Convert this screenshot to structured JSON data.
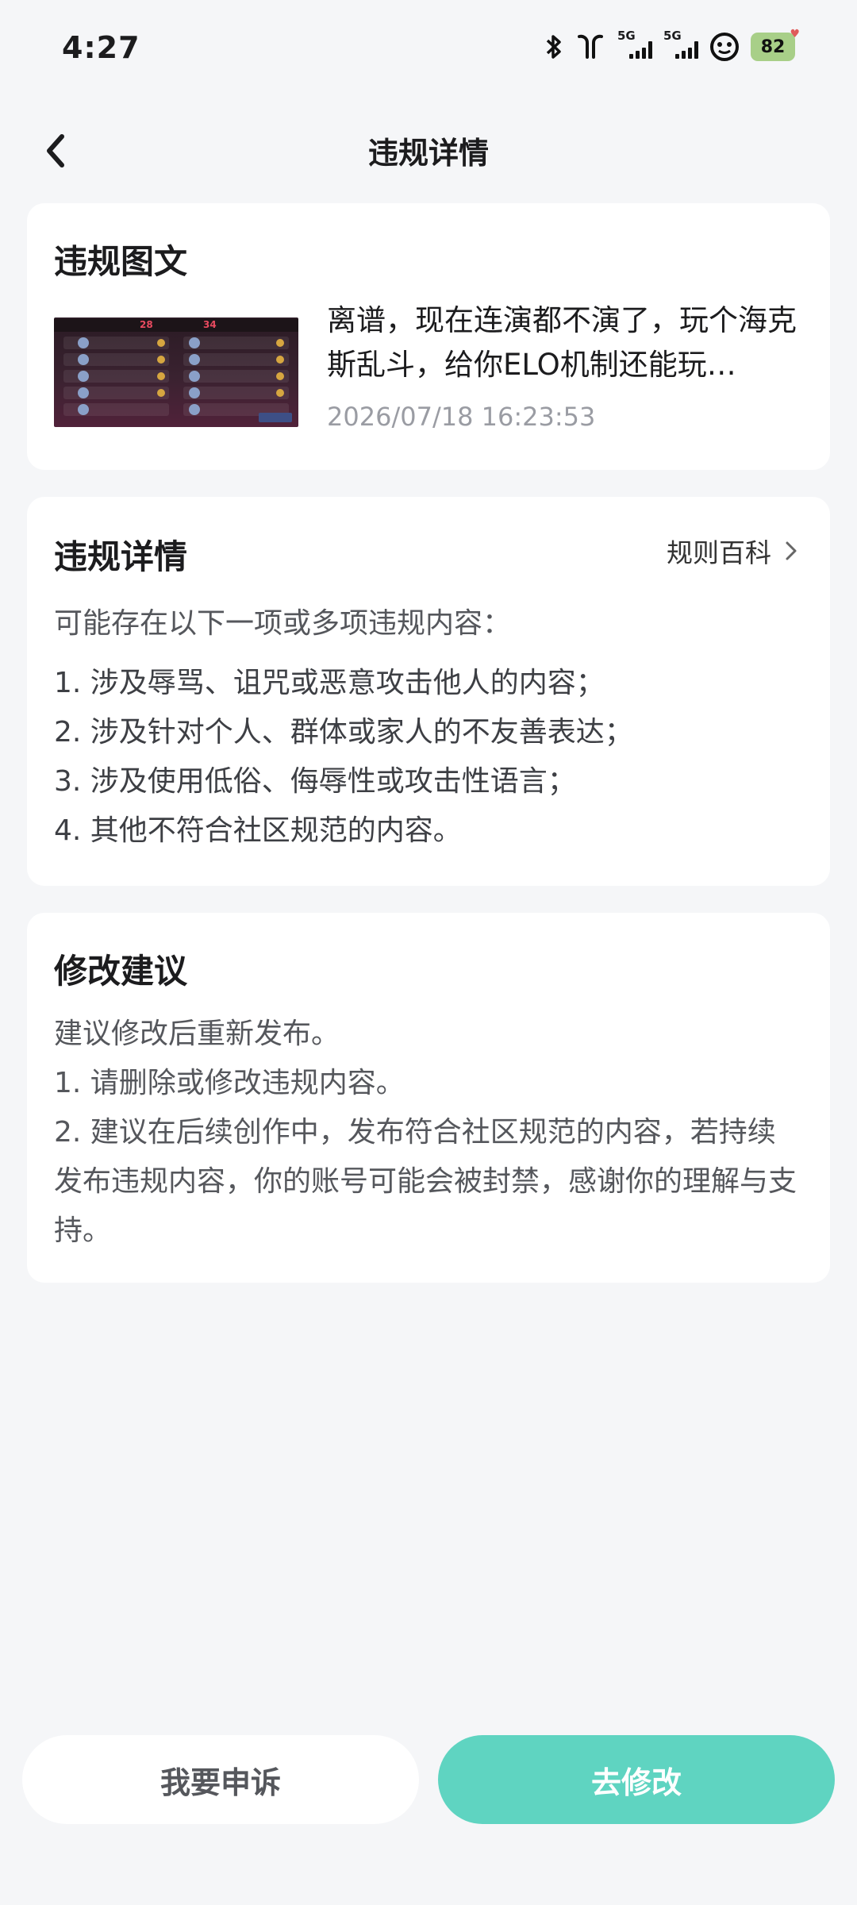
{
  "status_bar": {
    "time": "4:27",
    "network_type_1": "5G",
    "network_type_2": "5G",
    "battery_level": "82",
    "icons": [
      "bluetooth-icon",
      "earbuds-icon",
      "signal-icon",
      "signal-icon",
      "pet-app-icon",
      "battery-icon"
    ]
  },
  "nav": {
    "title": "违规详情",
    "back_icon": "chevron-left-icon"
  },
  "violation_content": {
    "title": "违规图文",
    "post_text": "离谱，现在连演都不演了，玩个海克斯乱斗，给你ELO机制还能玩…",
    "post_time": "2026/07/18 16:23:53",
    "thumbnail_scores": [
      "28",
      "34"
    ]
  },
  "violation_details": {
    "title": "违规详情",
    "rules_link": "规则百科",
    "intro": "可能存在以下一项或多项违规内容：",
    "items": [
      "1. 涉及辱骂、诅咒或恶意攻击他人的内容；",
      "2. 涉及针对个人、群体或家人的不友善表达；",
      "3. 涉及使用低俗、侮辱性或攻击性语言；",
      "4. 其他不符合社区规范的内容。"
    ]
  },
  "suggestions": {
    "title": "修改建议",
    "lines": [
      "建议修改后重新发布。",
      "1. 请删除或修改违规内容。",
      "2. 建议在后续创作中，发布符合社区规范的内容，若持续发布违规内容，你的账号可能会被封禁，感谢你的理解与支持。"
    ]
  },
  "actions": {
    "appeal_label": "我要申诉",
    "edit_label": "去修改"
  },
  "colors": {
    "background": "#f5f6f8",
    "card": "#ffffff",
    "accent": "#5fd4c1",
    "secondary_text": "#9a9ca3"
  }
}
